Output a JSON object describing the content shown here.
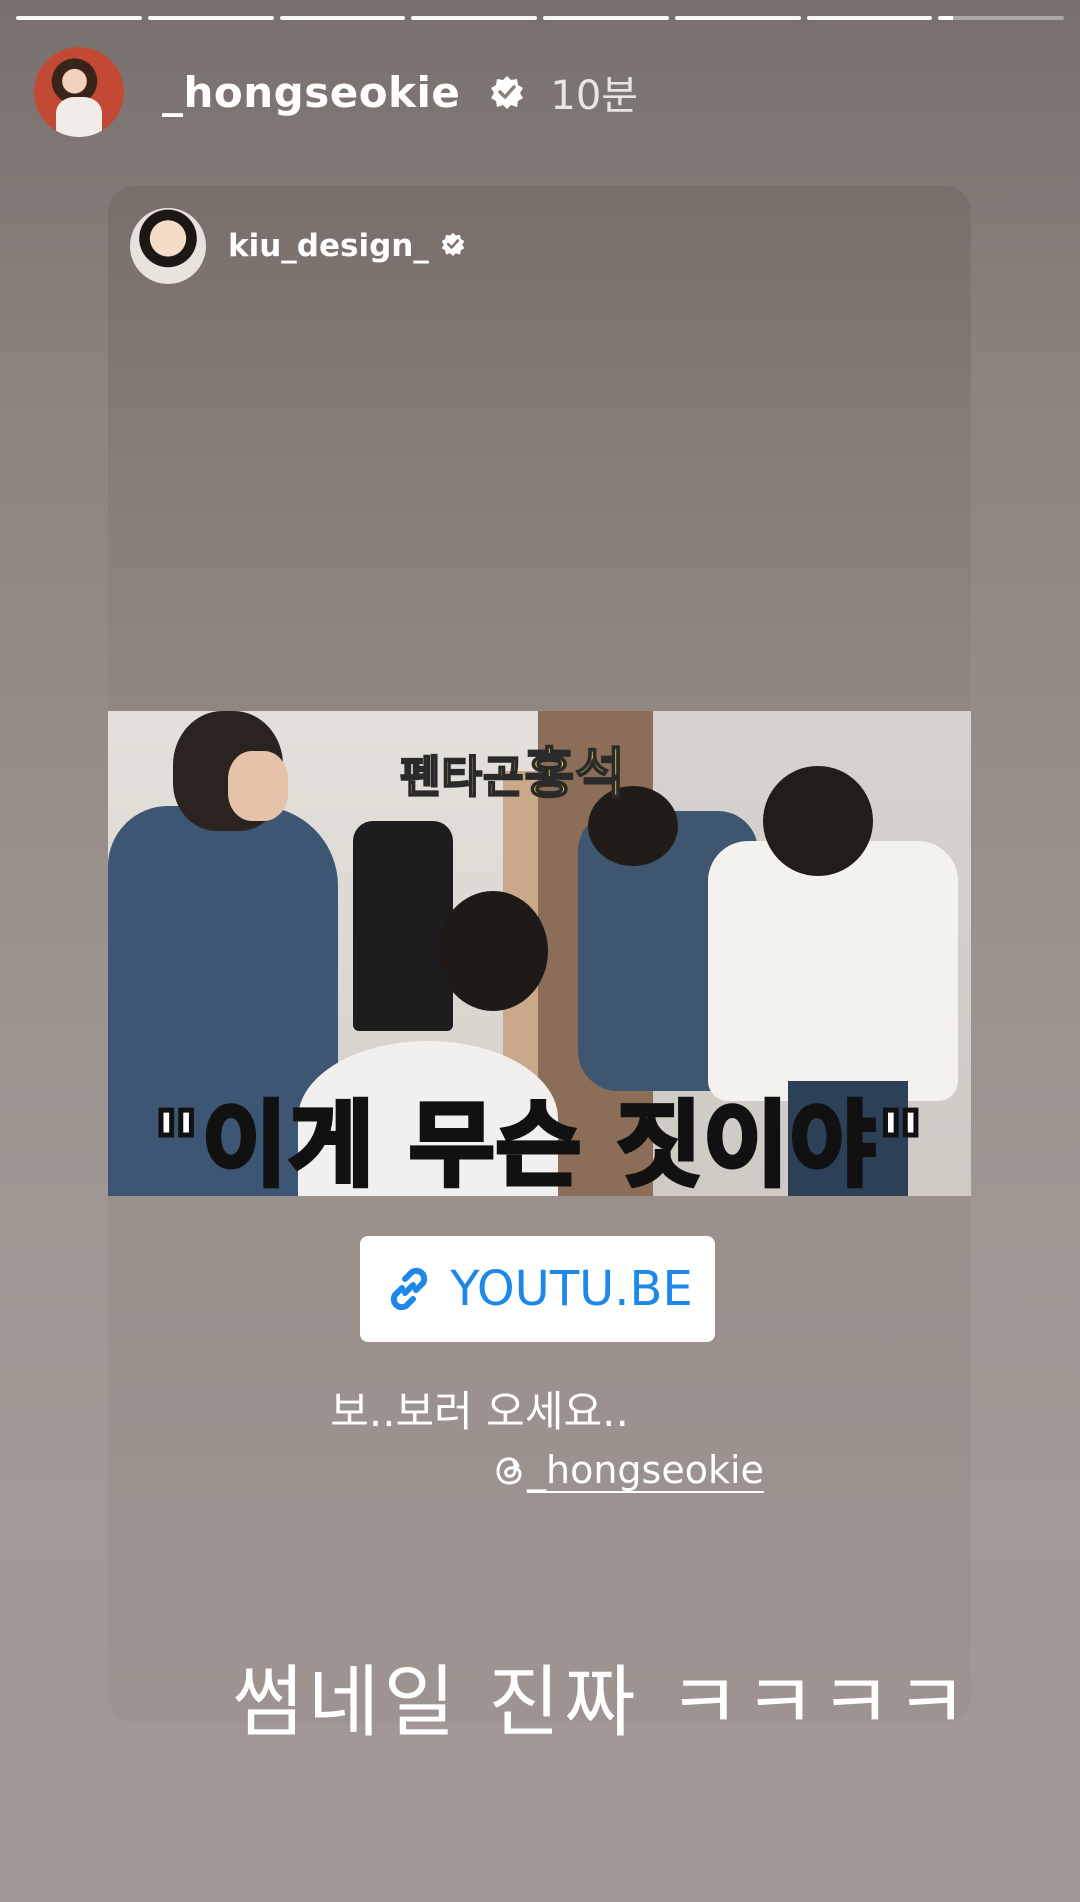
{
  "story": {
    "progress_segments_complete": 7,
    "progress_segments_total": 8,
    "current_segment_fraction": 0.12
  },
  "header": {
    "username": "_hongseokie",
    "time": "10분",
    "verified_icon": "verified-badge-icon"
  },
  "shared_post": {
    "username": "kiu_design_",
    "verified_icon": "verified-badge-icon",
    "thumbnail": {
      "top_text_small": "펜타곤",
      "top_text_big": "홍석",
      "caption": "\"이게 무슨 짓이야\""
    },
    "link_sticker": {
      "icon": "link-icon",
      "label": "YOUTU.BE"
    },
    "text": "보..보러 오세요..",
    "threads_icon": "threads-icon",
    "mention": "_hongseokie"
  },
  "overlay_text": "썸네일 진짜 ㅋㅋㅋㅋ",
  "colors": {
    "link_blue": "#1d88ea",
    "caption_yellow": "#f6e24a"
  }
}
